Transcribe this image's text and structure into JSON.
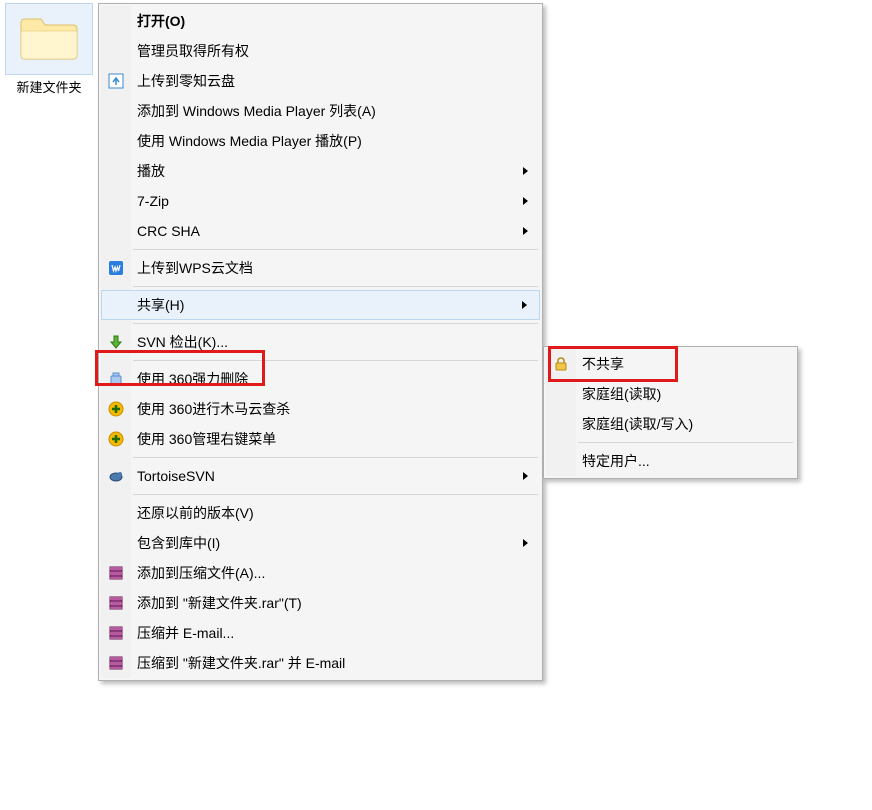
{
  "desktop": {
    "folder_label": "新建文件夹"
  },
  "menu": {
    "items": [
      {
        "label": "打开(O)",
        "bold": true
      },
      {
        "label": "管理员取得所有权"
      },
      {
        "label": "上传到零知云盘",
        "icon": "cloud-upload"
      },
      {
        "label": "添加到 Windows Media Player 列表(A)"
      },
      {
        "label": "使用 Windows Media Player 播放(P)"
      },
      {
        "label": "播放",
        "submenu": true
      },
      {
        "label": "7-Zip",
        "submenu": true
      },
      {
        "label": "CRC SHA",
        "submenu": true
      },
      {
        "separator": true
      },
      {
        "label": "上传到WPS云文档",
        "icon": "wps"
      },
      {
        "separator": true
      },
      {
        "label": "共享(H)",
        "submenu": true,
        "highlighted": true
      },
      {
        "separator": true
      },
      {
        "label": "SVN 检出(K)...",
        "icon": "svn-checkout"
      },
      {
        "separator": true
      },
      {
        "label": "使用 360强力删除",
        "icon": "delete-360"
      },
      {
        "label": "使用 360进行木马云查杀",
        "icon": "plus-shield"
      },
      {
        "label": "使用 360管理右键菜单",
        "icon": "plus-shield"
      },
      {
        "separator": true
      },
      {
        "label": "TortoiseSVN",
        "submenu": true,
        "icon": "tortoise"
      },
      {
        "separator": true
      },
      {
        "label": "还原以前的版本(V)"
      },
      {
        "label": "包含到库中(I)",
        "submenu": true
      },
      {
        "label": "添加到压缩文件(A)...",
        "icon": "archive"
      },
      {
        "label": "添加到 \"新建文件夹.rar\"(T)",
        "icon": "archive"
      },
      {
        "label": "压缩并 E-mail...",
        "icon": "archive"
      },
      {
        "label": "压缩到 \"新建文件夹.rar\" 并 E-mail",
        "icon": "archive"
      }
    ]
  },
  "submenu": {
    "items": [
      {
        "label": "不共享",
        "icon": "lock"
      },
      {
        "label": "家庭组(读取)"
      },
      {
        "label": "家庭组(读取/写入)"
      },
      {
        "separator": true
      },
      {
        "label": "特定用户..."
      }
    ]
  }
}
